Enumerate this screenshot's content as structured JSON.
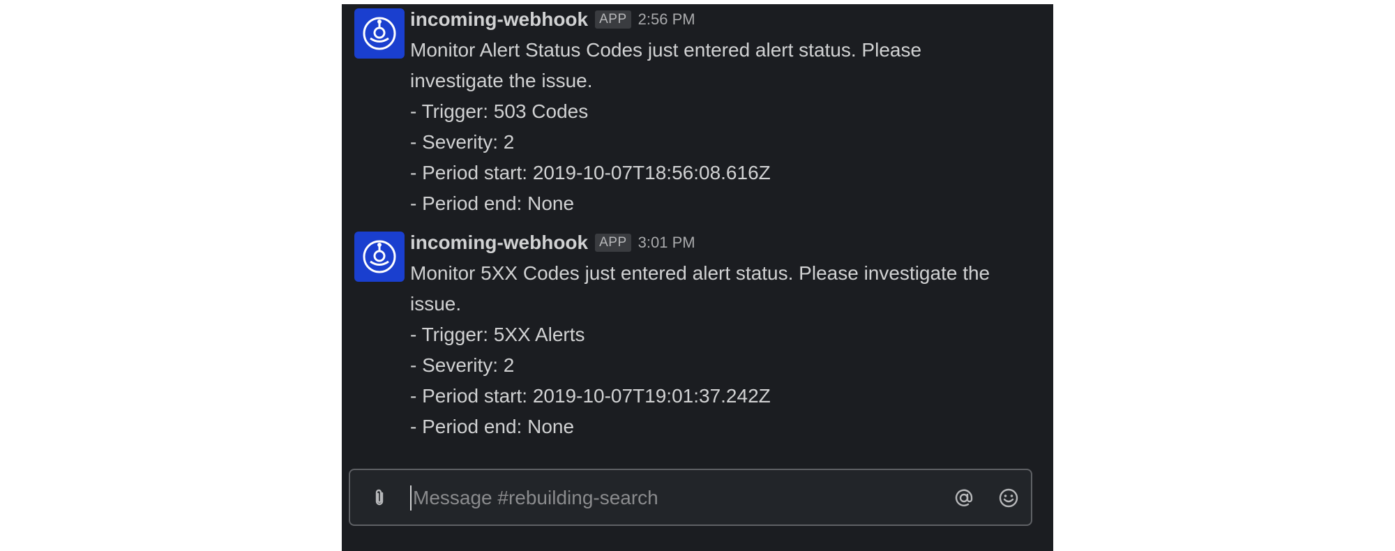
{
  "messages": [
    {
      "username": "incoming-webhook",
      "badge": "APP",
      "time": "2:56 PM",
      "lines": [
        "Monitor Alert Status Codes just entered alert status. Please",
        "investigate the issue.",
        "- Trigger: 503 Codes",
        "- Severity: 2",
        "- Period start: 2019-10-07T18:56:08.616Z",
        "- Period end: None"
      ]
    },
    {
      "username": "incoming-webhook",
      "badge": "APP",
      "time": "3:01 PM",
      "lines": [
        "Monitor 5XX Codes just entered alert status. Please investigate the",
        "issue.",
        "- Trigger: 5XX Alerts",
        "- Severity: 2",
        "- Period start: 2019-10-07T19:01:37.242Z",
        "- Period end: None"
      ]
    }
  ],
  "composer": {
    "placeholder": "Message #rebuilding-search",
    "icons": {
      "attach": "paperclip-icon",
      "mention": "at-sign-icon",
      "emoji": "smiley-icon"
    }
  },
  "colors": {
    "background": "#1b1d21",
    "avatar": "#1a3fcf",
    "text": "#d1d2d3",
    "muted": "#a9aaac"
  }
}
